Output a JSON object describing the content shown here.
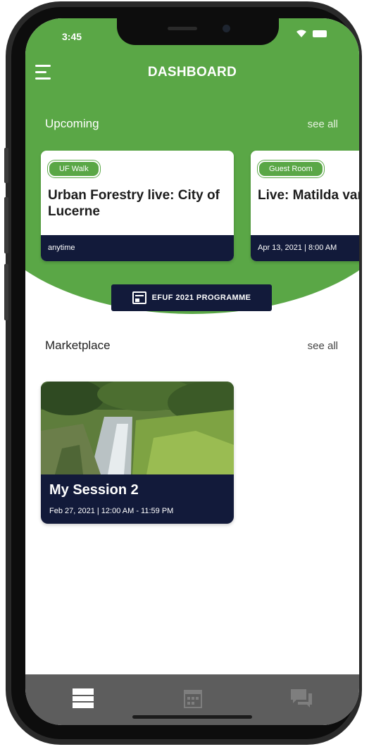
{
  "status_bar": {
    "time": "3:45"
  },
  "header": {
    "title": "DASHBOARD"
  },
  "upcoming": {
    "title": "Upcoming",
    "see_all": "see all",
    "cards": [
      {
        "tag": "UF Walk",
        "title": "Urban Forestry live: City of Lucerne",
        "time": "anytime"
      },
      {
        "tag": "Guest Room",
        "title": "Live: Matilda van den Bosch",
        "time": "Apr 13, 2021 | 8:00 AM"
      }
    ]
  },
  "programme_button": {
    "label": "EFUF 2021 PROGRAMME"
  },
  "marketplace": {
    "title": "Marketplace",
    "see_all": "see all",
    "session": {
      "title": "My Session 2",
      "time": "Feb 27, 2021 | 12:00 AM - 11:59 PM"
    }
  },
  "tabbar": {
    "tabs": [
      "dashboard-icon",
      "calendar-icon",
      "chat-icon"
    ],
    "active": 0
  },
  "colors": {
    "green": "#5aa746",
    "navy": "#121a3a",
    "tabbar": "#5d5d5d"
  }
}
